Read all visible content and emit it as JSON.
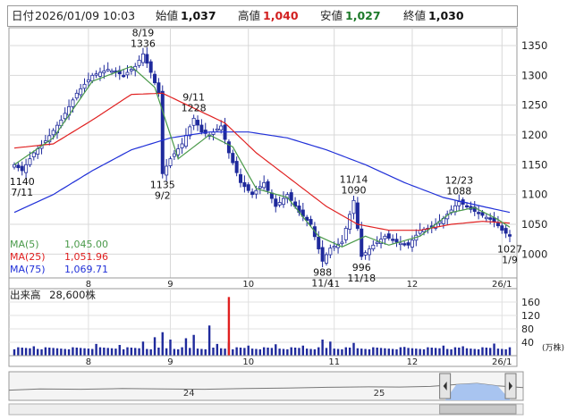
{
  "header": {
    "date_label": "日付",
    "datetime": "2026/01/09 10:03",
    "open_label": "始値",
    "open_value": "1,037",
    "high_label": "高値",
    "high_value": "1,040",
    "low_label": "安値",
    "low_value": "1,027",
    "close_label": "終値",
    "close_value": "1,030"
  },
  "colors": {
    "up": "#ffffff",
    "down": "#1f2a9c",
    "ma5": "#4a9a4a",
    "ma25": "#e02020",
    "ma75": "#2030d8",
    "volume": "#1f2a9c",
    "volume_spike": "#e02020",
    "navigator_fill": "#a8c4f0"
  },
  "ma_legend": [
    {
      "name": "MA(5)",
      "value": "1,045.00",
      "color": "#4a9a4a"
    },
    {
      "name": "MA(25)",
      "value": "1,051.96",
      "color": "#e02020"
    },
    {
      "name": "MA(75)",
      "value": "1,069.71",
      "color": "#2030d8"
    }
  ],
  "volume_label": "出来高",
  "volume_value": "28,600株",
  "volume_unit": "(万株)",
  "chart_data": [
    {
      "type": "candlestick",
      "title": "",
      "ylim": [
        960,
        1380
      ],
      "y_ticks": [
        1000,
        1050,
        1100,
        1150,
        1200,
        1250,
        1300,
        1350
      ],
      "x_ticks": [
        "8",
        "9",
        "10",
        "11",
        "12",
        "26/1"
      ],
      "x_tick_days": [
        19,
        40,
        60,
        82,
        102,
        125
      ],
      "n_days": 128,
      "grid": true,
      "annotations": [
        {
          "date": "8/19",
          "value": "1336",
          "day": 33,
          "price": 1336,
          "pos": "above"
        },
        {
          "date": "9/11",
          "value": "1228",
          "day": 46,
          "price": 1228,
          "pos": "above"
        },
        {
          "date": "11/14",
          "value": "1090",
          "day": 87,
          "price": 1090,
          "pos": "above"
        },
        {
          "date": "12/23",
          "value": "1088",
          "day": 114,
          "price": 1088,
          "pos": "above"
        },
        {
          "date": "7/11",
          "value": "1140",
          "day": 2,
          "price": 1140,
          "pos": "below"
        },
        {
          "date": "9/2",
          "value": "1135",
          "day": 38,
          "price": 1135,
          "pos": "below"
        },
        {
          "date": "11/4",
          "value": "988",
          "day": 79,
          "price": 988,
          "pos": "below"
        },
        {
          "date": "11/18",
          "value": "996",
          "day": 89,
          "price": 996,
          "pos": "below"
        },
        {
          "date": "1/9",
          "value": "1027",
          "day": 127,
          "price": 1027,
          "pos": "below"
        }
      ],
      "ohlc_anchors": [
        [
          0,
          1150
        ],
        [
          2,
          1140
        ],
        [
          5,
          1170
        ],
        [
          8,
          1190
        ],
        [
          12,
          1225
        ],
        [
          16,
          1270
        ],
        [
          20,
          1300
        ],
        [
          24,
          1310
        ],
        [
          28,
          1300
        ],
        [
          31,
          1315
        ],
        [
          33,
          1336
        ],
        [
          35,
          1305
        ],
        [
          37,
          1270
        ],
        [
          38,
          1135
        ],
        [
          40,
          1160
        ],
        [
          43,
          1185
        ],
        [
          46,
          1228
        ],
        [
          48,
          1205
        ],
        [
          50,
          1200
        ],
        [
          53,
          1215
        ],
        [
          55,
          1170
        ],
        [
          58,
          1120
        ],
        [
          61,
          1100
        ],
        [
          64,
          1120
        ],
        [
          67,
          1080
        ],
        [
          70,
          1100
        ],
        [
          73,
          1070
        ],
        [
          76,
          1050
        ],
        [
          79,
          988
        ],
        [
          81,
          1010
        ],
        [
          84,
          1020
        ],
        [
          87,
          1090
        ],
        [
          89,
          996
        ],
        [
          92,
          1015
        ],
        [
          95,
          1030
        ],
        [
          98,
          1020
        ],
        [
          101,
          1015
        ],
        [
          104,
          1040
        ],
        [
          107,
          1045
        ],
        [
          110,
          1060
        ],
        [
          114,
          1088
        ],
        [
          117,
          1075
        ],
        [
          120,
          1065
        ],
        [
          123,
          1055
        ],
        [
          125,
          1040
        ],
        [
          127,
          1030
        ]
      ],
      "ma5_anchors": [
        [
          0,
          1150
        ],
        [
          10,
          1195
        ],
        [
          20,
          1290
        ],
        [
          30,
          1315
        ],
        [
          36,
          1280
        ],
        [
          42,
          1160
        ],
        [
          50,
          1200
        ],
        [
          56,
          1180
        ],
        [
          62,
          1110
        ],
        [
          70,
          1095
        ],
        [
          78,
          1030
        ],
        [
          84,
          1012
        ],
        [
          90,
          1030
        ],
        [
          96,
          1015
        ],
        [
          104,
          1030
        ],
        [
          112,
          1070
        ],
        [
          118,
          1078
        ],
        [
          124,
          1058
        ],
        [
          127,
          1045
        ]
      ],
      "ma25_anchors": [
        [
          0,
          1178
        ],
        [
          10,
          1185
        ],
        [
          20,
          1225
        ],
        [
          30,
          1268
        ],
        [
          38,
          1270
        ],
        [
          46,
          1245
        ],
        [
          54,
          1220
        ],
        [
          62,
          1170
        ],
        [
          72,
          1120
        ],
        [
          80,
          1080
        ],
        [
          88,
          1050
        ],
        [
          96,
          1040
        ],
        [
          104,
          1040
        ],
        [
          112,
          1050
        ],
        [
          120,
          1055
        ],
        [
          127,
          1052
        ]
      ],
      "ma75_anchors": [
        [
          0,
          1070
        ],
        [
          10,
          1100
        ],
        [
          20,
          1140
        ],
        [
          30,
          1175
        ],
        [
          40,
          1195
        ],
        [
          50,
          1205
        ],
        [
          60,
          1205
        ],
        [
          70,
          1195
        ],
        [
          80,
          1175
        ],
        [
          90,
          1150
        ],
        [
          100,
          1120
        ],
        [
          110,
          1095
        ],
        [
          120,
          1080
        ],
        [
          127,
          1070
        ]
      ]
    },
    {
      "type": "bar",
      "title": "",
      "ylabel": "(万株)",
      "ylim": [
        0,
        200
      ],
      "y_ticks": [
        40,
        80,
        120,
        160
      ],
      "baseline": 22,
      "spikes": [
        {
          "day": 5,
          "value": 28
        },
        {
          "day": 21,
          "value": 35
        },
        {
          "day": 27,
          "value": 32
        },
        {
          "day": 33,
          "value": 42
        },
        {
          "day": 36,
          "value": 55
        },
        {
          "day": 38,
          "value": 70
        },
        {
          "day": 40,
          "value": 48
        },
        {
          "day": 44,
          "value": 52
        },
        {
          "day": 46,
          "value": 62
        },
        {
          "day": 50,
          "value": 90
        },
        {
          "day": 52,
          "value": 35
        },
        {
          "day": 55,
          "value": 38
        },
        {
          "day": 60,
          "value": 30
        },
        {
          "day": 67,
          "value": 34
        },
        {
          "day": 74,
          "value": 30
        },
        {
          "day": 79,
          "value": 48
        },
        {
          "day": 81,
          "value": 42
        },
        {
          "day": 87,
          "value": 38
        },
        {
          "day": 100,
          "value": 26
        },
        {
          "day": 110,
          "value": 30
        },
        {
          "day": 115,
          "value": 28
        },
        {
          "day": 123,
          "value": 36
        }
      ],
      "spike_red": {
        "day": 55,
        "value": 175
      }
    },
    {
      "type": "area",
      "title": "",
      "x_ticks": [
        "24",
        "25"
      ],
      "x_tick_frac": [
        0.35,
        0.72
      ],
      "window_frac": [
        0.855,
        1.0
      ],
      "profile": [
        [
          0,
          0.42
        ],
        [
          0.06,
          0.5
        ],
        [
          0.14,
          0.48
        ],
        [
          0.22,
          0.52
        ],
        [
          0.3,
          0.5
        ],
        [
          0.38,
          0.48
        ],
        [
          0.46,
          0.52
        ],
        [
          0.54,
          0.55
        ],
        [
          0.62,
          0.6
        ],
        [
          0.7,
          0.63
        ],
        [
          0.76,
          0.62
        ],
        [
          0.82,
          0.66
        ],
        [
          0.87,
          0.78
        ],
        [
          0.91,
          0.85
        ],
        [
          0.95,
          0.7
        ],
        [
          1.0,
          0.58
        ]
      ]
    }
  ]
}
